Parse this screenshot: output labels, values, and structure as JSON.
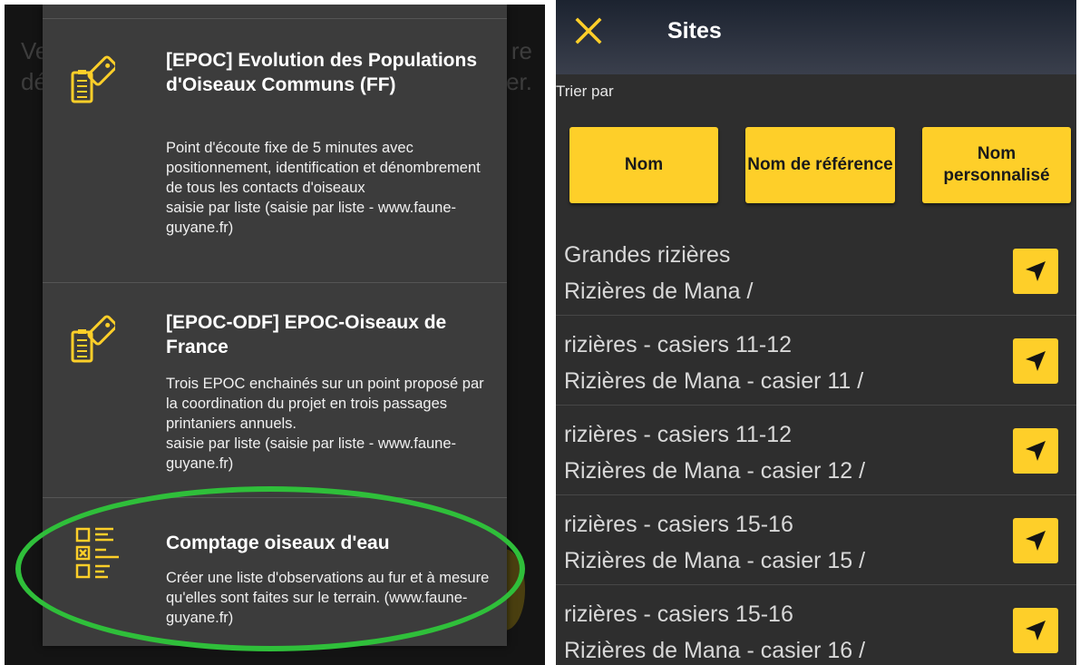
{
  "left_panel": {
    "background_text": {
      "left_top": "Ve",
      "left_bottom": "dé",
      "right_top": "re",
      "right_bottom": "er."
    },
    "protocols": [
      {
        "icon": "clipboard-tag-icon",
        "title": "[EPOC] Evolution des Populations d'Oiseaux Communs (FF)",
        "description": "Point d'écoute fixe de 5 minutes avec positionnement, identification et dénombrement de tous les contacts d'oiseaux",
        "entry_mode": "saisie par liste (saisie par liste - www.faune-guyane.fr)"
      },
      {
        "icon": "clipboard-tag-icon",
        "title": "[EPOC-ODF] EPOC-Oiseaux de France",
        "description": "Trois EPOC enchainés sur un point proposé par la coordination du projet en trois passages printaniers annuels.",
        "entry_mode": "saisie par liste (saisie par liste - www.faune-guyane.fr)"
      },
      {
        "icon": "checklist-icon",
        "title": "Comptage oiseaux d'eau",
        "description": "Créer une liste d'observations au fur et à mesure qu'elles sont faites sur le terrain. (www.faune-guyane.fr)",
        "highlighted": true
      }
    ]
  },
  "right_panel": {
    "app_bar": {
      "close_icon": "close-icon",
      "title": "Sites"
    },
    "sort_label": "Trier par",
    "sort_buttons": [
      {
        "label": "Nom"
      },
      {
        "label": "Nom de référence"
      },
      {
        "label": "Nom personnalisé"
      }
    ],
    "sites": [
      {
        "name": "Grandes rizières",
        "reference": "Rizières de Mana /"
      },
      {
        "name": "rizières - casiers 11-12",
        "reference": "Rizières de Mana - casier 11 /"
      },
      {
        "name": "rizières - casiers 11-12",
        "reference": "Rizières de Mana - casier 12 /"
      },
      {
        "name": "rizières - casiers 15-16",
        "reference": "Rizières de Mana - casier 15 /"
      },
      {
        "name": "rizières - casiers 15-16",
        "reference": "Rizières de Mana - casier 16 /"
      }
    ],
    "site_action_icon": "navigation-arrow-icon"
  },
  "colors": {
    "accent": "#fecf29",
    "highlight_ellipse": "#2fbf3a",
    "sheet_background": "#3c3c3c",
    "list_background": "#2e2e2e"
  }
}
